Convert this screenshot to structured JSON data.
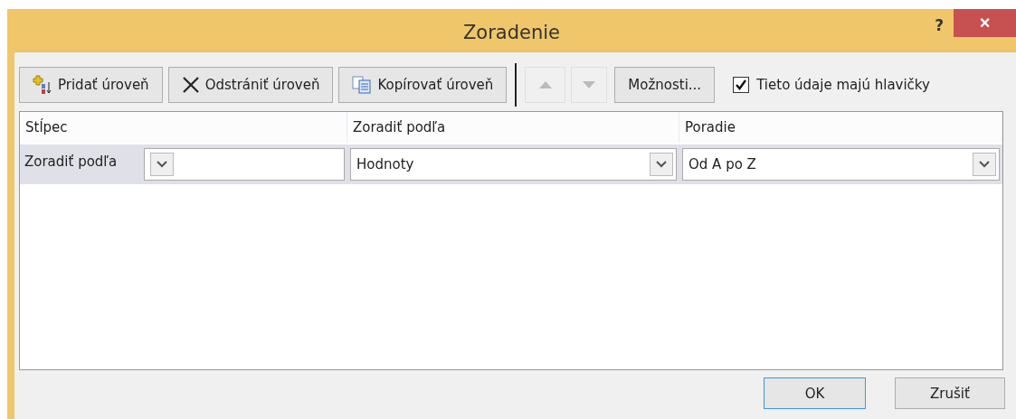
{
  "window": {
    "title": "Zoradenie",
    "help": "?",
    "close": "×"
  },
  "toolbar": [
    {
      "kind": "add",
      "label": "Pridať úroveň",
      "disabled": false
    },
    {
      "kind": "delete",
      "label": "Odstrániť úroveň",
      "disabled": false
    },
    {
      "kind": "copy",
      "label": "Kopírovať úroveň",
      "disabled": false
    },
    {
      "kind": "up",
      "disabled": true
    },
    {
      "kind": "down",
      "disabled": true
    },
    {
      "kind": "options",
      "label": "Možnosti...",
      "disabled": false
    }
  ],
  "headers_checkbox": {
    "label": "Tieto údaje majú hlavičky",
    "checked": true
  },
  "table": {
    "columns": [
      "Stĺpec",
      "Zoradiť podľa",
      "Poradie"
    ],
    "rows": [
      {
        "label": "Zoradiť podľa",
        "selected": true,
        "column": "",
        "sort_on": "Hodnoty",
        "order": "Od A po Z"
      }
    ]
  },
  "buttons": [
    {
      "label": "OK",
      "default": true
    },
    {
      "label": "Zrušiť",
      "default": false
    }
  ]
}
